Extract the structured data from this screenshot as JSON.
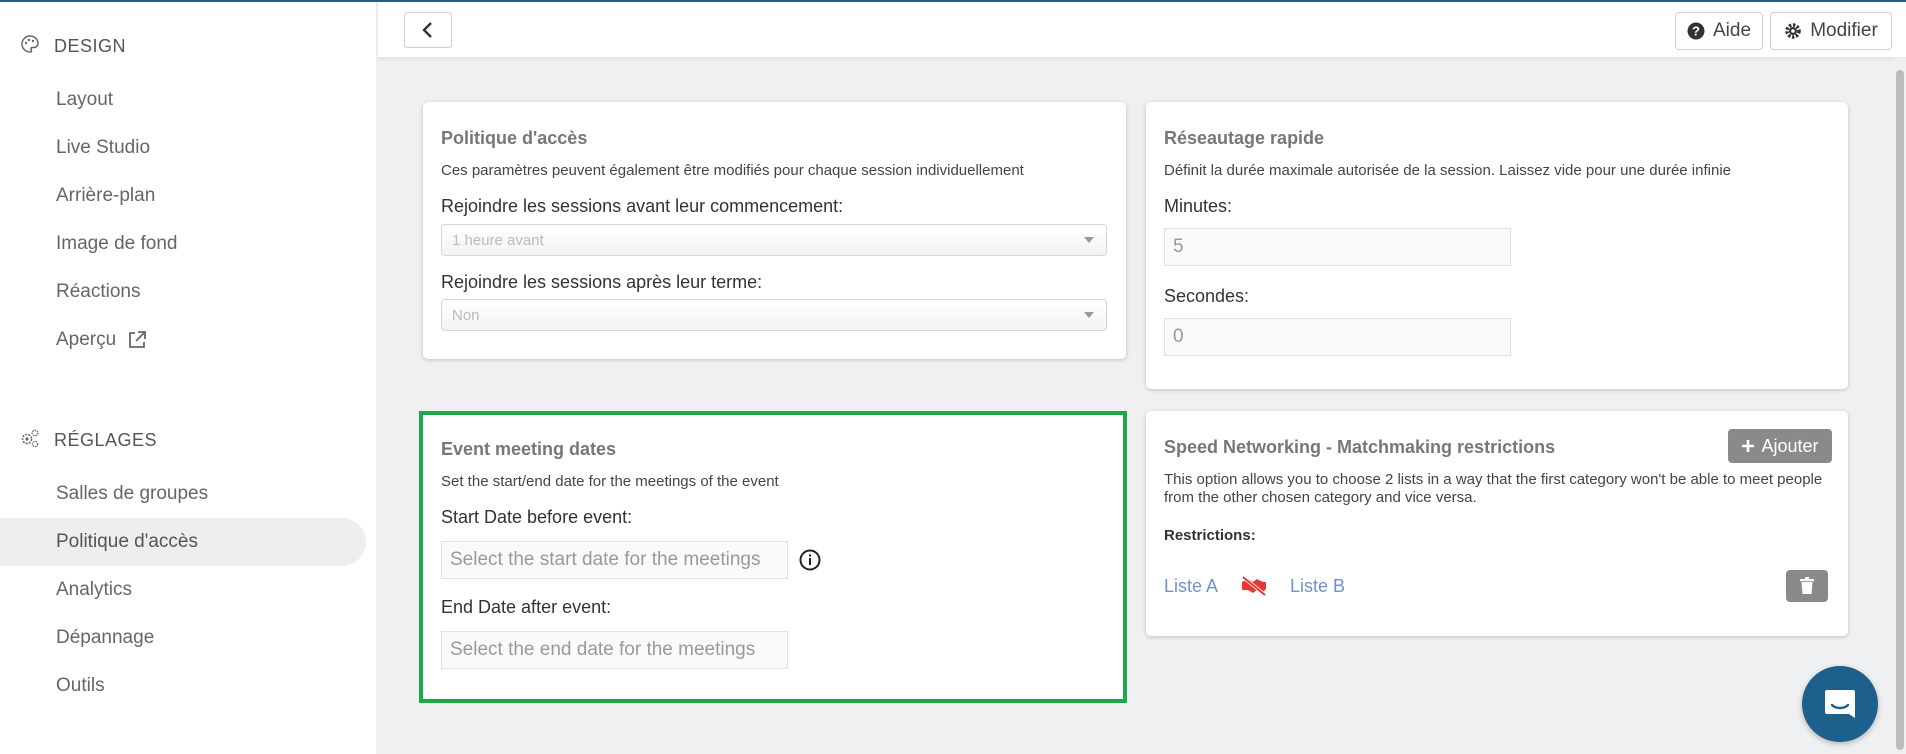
{
  "sidebar": {
    "design": {
      "title": "DESIGN",
      "icon": "palette-icon",
      "items": [
        "Layout",
        "Live Studio",
        "Arrière-plan",
        "Image de fond",
        "Réactions",
        "Aperçu"
      ]
    },
    "reglages": {
      "title": "RÉGLAGES",
      "icon": "gears-icon",
      "items": [
        "Salles de groupes",
        "Politique d'accès",
        "Analytics",
        "Dépannage",
        "Outils"
      ],
      "active": "Politique d'accès"
    }
  },
  "topbar": {
    "back_icon": "chevron-left-icon",
    "help_label": "Aide",
    "modify_label": "Modifier"
  },
  "access_policy": {
    "title": "Politique d'accès",
    "description": "Ces paramètres peuvent également être modifiés pour chaque session individuellement",
    "before_label": "Rejoindre les sessions avant leur commencement:",
    "before_value": "1 heure avant",
    "after_label": "Rejoindre les sessions après leur terme:",
    "after_value": "Non"
  },
  "meeting_dates": {
    "title": "Event meeting dates",
    "description": "Set the start/end date for the meetings of the event",
    "start_label": "Start Date before event:",
    "start_placeholder": "Select the start date for the meetings",
    "end_label": "End Date after event:",
    "end_placeholder": "Select the end date for the meetings"
  },
  "quick_networking": {
    "title": "Réseautage rapide",
    "description": "Définit la durée maximale autorisée de la session. Laissez vide pour une durée infinie",
    "minutes_label": "Minutes:",
    "minutes_value": "5",
    "seconds_label": "Secondes:",
    "seconds_value": "0"
  },
  "restrictions": {
    "title": "Speed Networking - Matchmaking restrictions",
    "add_label": "Ajouter",
    "description": "This option allows you to choose 2 lists in a way that the first category won't be able to meet people from the other chosen category and vice versa.",
    "restrictions_label": "Restrictions:",
    "list_a": "Liste A",
    "list_b": "Liste B"
  },
  "colors": {
    "highlight": "#1fa84b",
    "brand": "#1d5f8d",
    "link": "#6f93c9",
    "danger": "#e53935"
  }
}
